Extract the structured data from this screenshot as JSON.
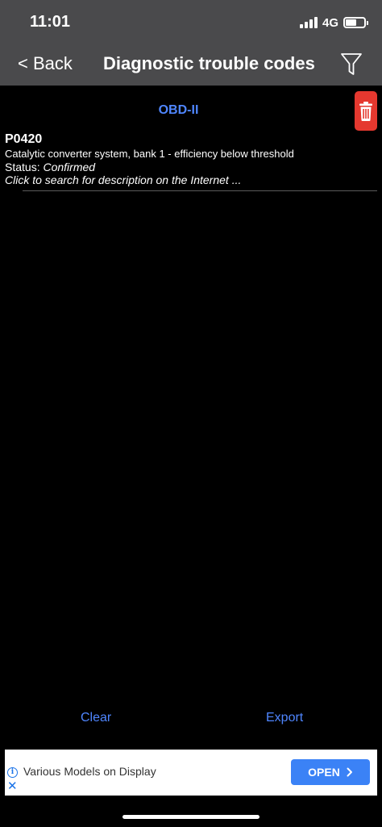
{
  "status_bar": {
    "time": "11:01",
    "network": "4G",
    "battery_level": 0.6
  },
  "nav": {
    "back_label": "< Back",
    "title": "Diagnostic trouble codes",
    "filter_icon": "filter-funnel-icon"
  },
  "section": {
    "title": "OBD-II",
    "trash_icon": "trash-icon",
    "trash_color": "#e5382f",
    "accent_color": "#4f86ff"
  },
  "dtcs": [
    {
      "code": "P0420",
      "description": "Catalytic converter system, bank 1 - efficiency below threshold",
      "status_label": "Status: ",
      "status_value": "Confirmed",
      "link_text": "Click to search for description on the Internet ..."
    }
  ],
  "actions": {
    "clear_label": "Clear",
    "export_label": "Export"
  },
  "ad": {
    "text": "Various Models on Display",
    "button_label": "OPEN",
    "button_color": "#3b82f6"
  }
}
